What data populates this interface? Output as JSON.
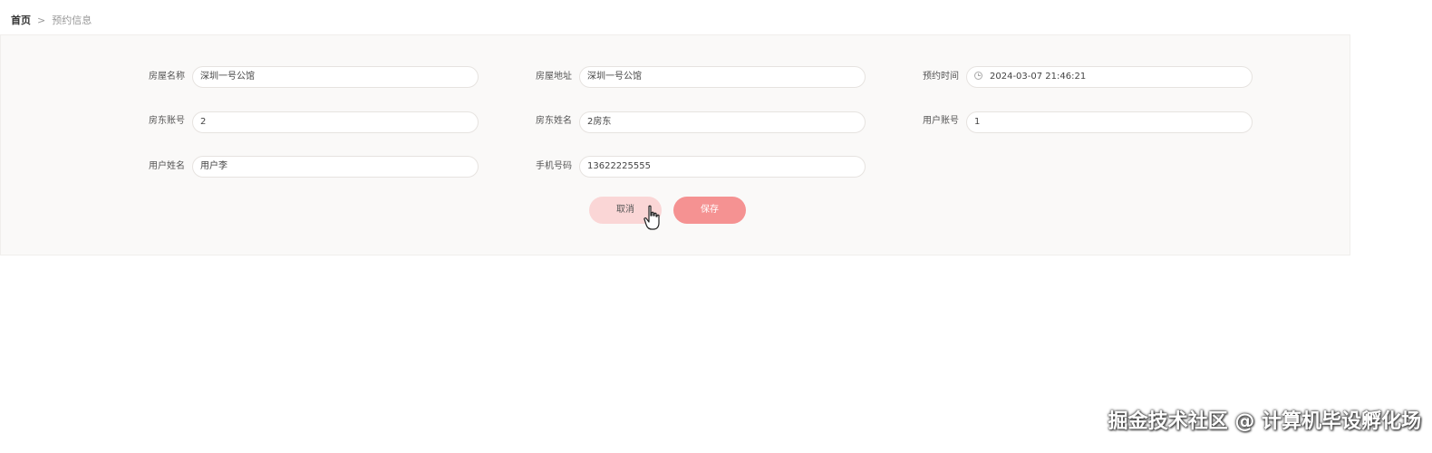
{
  "breadcrumb": {
    "home": "首页",
    "separator": ">",
    "current": "预约信息"
  },
  "form": {
    "house_name": {
      "label": "房屋名称",
      "value": "深圳一号公馆"
    },
    "house_address": {
      "label": "房屋地址",
      "value": "深圳一号公馆"
    },
    "booking_time": {
      "label": "预约时间",
      "value": "2024-03-07 21:46:21",
      "icon": "clock-icon"
    },
    "landlord_account": {
      "label": "房东账号",
      "value": "2"
    },
    "landlord_name": {
      "label": "房东姓名",
      "value": "2房东"
    },
    "user_account": {
      "label": "用户账号",
      "value": "1"
    },
    "user_name": {
      "label": "用户姓名",
      "value": "用户李"
    },
    "phone": {
      "label": "手机号码",
      "value": "13622225555"
    }
  },
  "actions": {
    "cancel_label": "取消",
    "save_label": "保存"
  },
  "watermark": "掘金技术社区 @ 计算机毕设孵化场",
  "colors": {
    "panel_bg": "#faf9f8",
    "cancel_bg": "#fad6d6",
    "save_bg": "#f59292"
  }
}
